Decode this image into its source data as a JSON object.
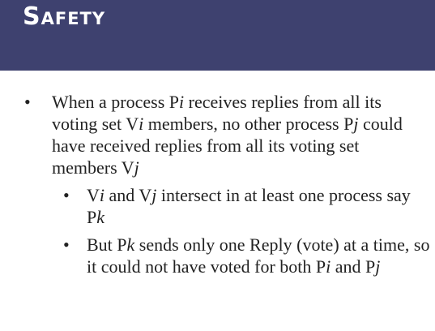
{
  "title": "Safety",
  "bullets": [
    {
      "glyph": "•",
      "parts": [
        "When a process P",
        "i",
        " receives replies from all its voting set V",
        "i",
        " members, no other process P",
        "j",
        " could have received replies from all its voting set members V",
        "j"
      ]
    }
  ],
  "sub_bullets": [
    {
      "glyph": "•",
      "parts": [
        "V",
        "i",
        " and V",
        "j",
        " intersect in at least one process say P",
        "k"
      ]
    },
    {
      "glyph": "•",
      "parts": [
        "But P",
        "k",
        " sends only one Reply (vote) at a time, so it could not have voted for both P",
        "i",
        " and P",
        "j"
      ]
    }
  ],
  "colors": {
    "header_bg": "#3e416f",
    "title_text": "#ffffff",
    "body_text": "#222222"
  }
}
